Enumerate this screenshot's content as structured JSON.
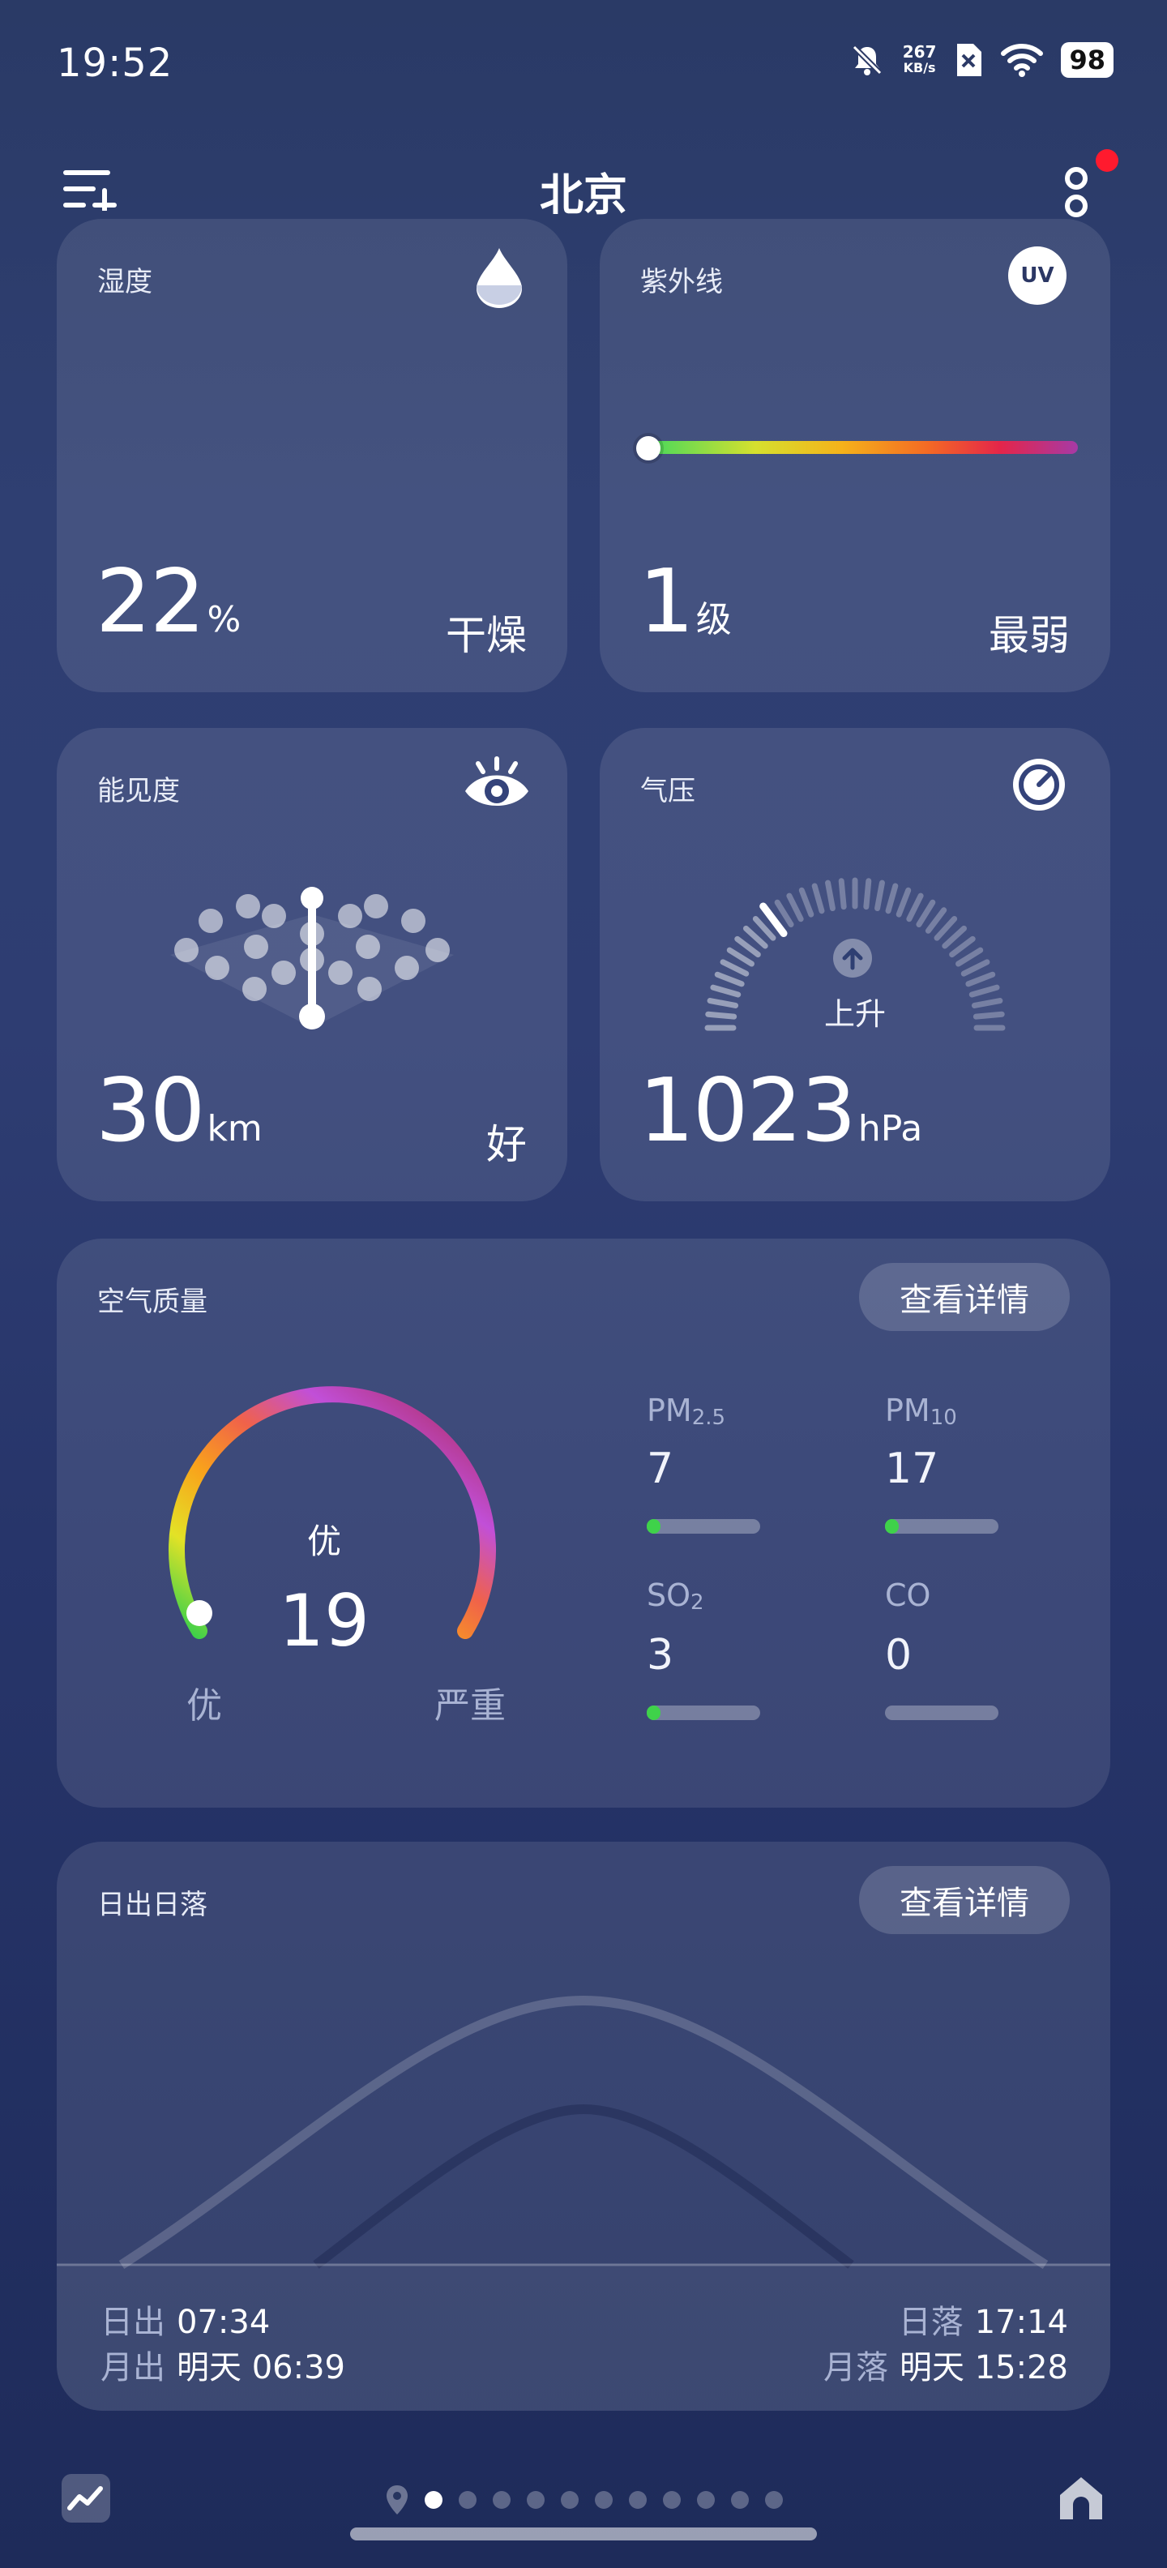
{
  "status_bar": {
    "time": "19:52",
    "net_speed_value": "267",
    "net_speed_unit": "KB/s",
    "battery": "98"
  },
  "header": {
    "city": "北京"
  },
  "humidity": {
    "title": "湿度",
    "value": "22",
    "unit": "%",
    "desc": "干燥",
    "icon": "droplet-icon"
  },
  "uv": {
    "title": "紫外线",
    "value": "1",
    "unit": "级",
    "desc": "最弱",
    "icon_text": "UV",
    "level_fraction": 0.0
  },
  "visibility": {
    "title": "能见度",
    "value": "30",
    "unit": "km",
    "desc": "好",
    "icon": "eye-icon"
  },
  "pressure": {
    "title": "气压",
    "value": "1023",
    "unit": "hPa",
    "trend": "上升",
    "icon": "gauge-icon"
  },
  "air_quality": {
    "title": "空气质量",
    "details_label": "查看详情",
    "level_text": "优",
    "aqi": "19",
    "scale_min_label": "优",
    "scale_max_label": "严重",
    "pollutants": [
      {
        "name": "PM",
        "sub": "2.5",
        "value": "7",
        "fill": 0.12
      },
      {
        "name": "PM",
        "sub": "10",
        "value": "17",
        "fill": 0.12
      },
      {
        "name": "SO",
        "sub": "2",
        "value": "3",
        "fill": 0.12
      },
      {
        "name": "CO",
        "sub": "",
        "value": "0",
        "fill": 0.0
      }
    ],
    "colors": {
      "good": "#3fd24a"
    }
  },
  "sun_moon": {
    "title": "日出日落",
    "details_label": "查看详情",
    "sunrise_label": "日出",
    "sunrise": "07:34",
    "moonrise_label": "月出",
    "moonrise": "明天 06:39",
    "sunset_label": "日落",
    "sunset": "17:14",
    "moonset_label": "月落",
    "moonset": "明天 15:28"
  },
  "pager": {
    "count": 11,
    "active": 0
  }
}
